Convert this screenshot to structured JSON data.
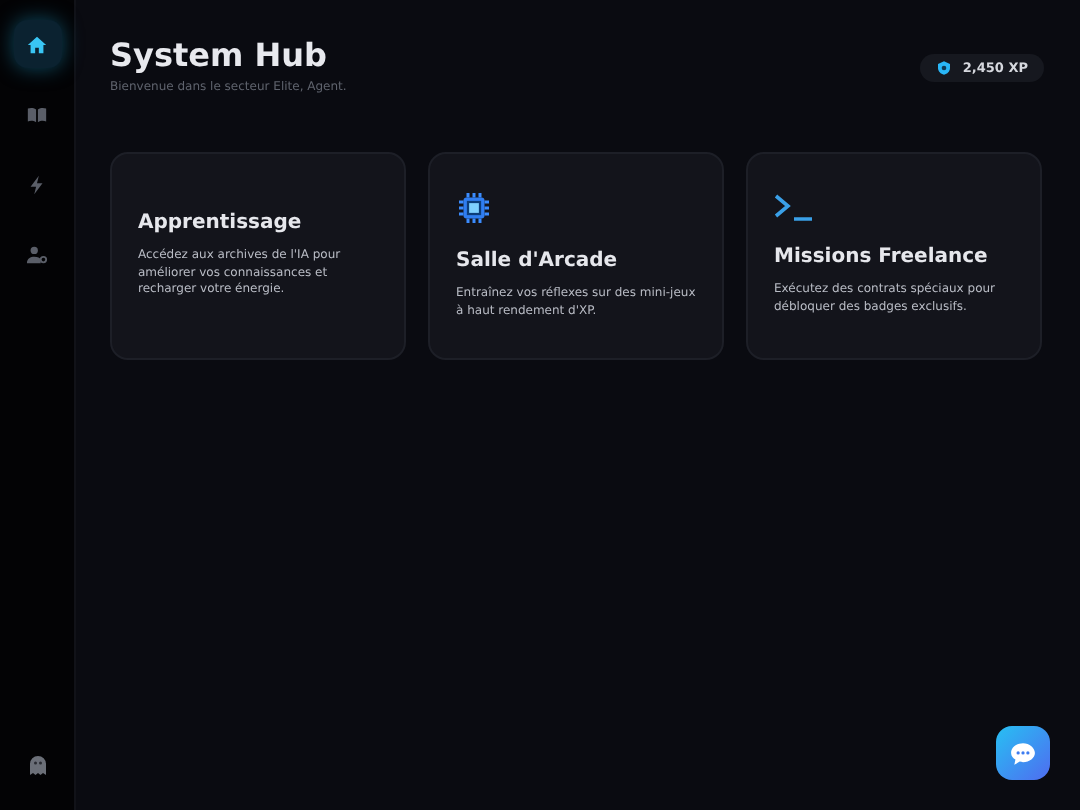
{
  "sidebar": {
    "items": [
      {
        "kind": "home",
        "selected": true
      },
      {
        "kind": "book",
        "selected": false
      },
      {
        "kind": "bolt",
        "selected": false
      },
      {
        "kind": "user",
        "selected": false
      }
    ]
  },
  "header": {
    "title": "System Hub",
    "subtitle": "Bienvenue dans le secteur Elite, Agent.",
    "xp_badge": "2,450 XP"
  },
  "cards": [
    {
      "kind": "plain",
      "title": "Apprentissage",
      "description": "Accédez aux archives de l'IA pour améliorer vos connaissances et recharger votre énergie."
    },
    {
      "kind": "chip",
      "title": "Salle d'Arcade",
      "description": "Entraînez vos réflexes sur des mini-jeux à haut rendement d'XP."
    },
    {
      "kind": "terminal",
      "title": "Missions Freelance",
      "description": "Exécutez des contrats spéciaux pour débloquer des badges exclusifs."
    }
  ]
}
